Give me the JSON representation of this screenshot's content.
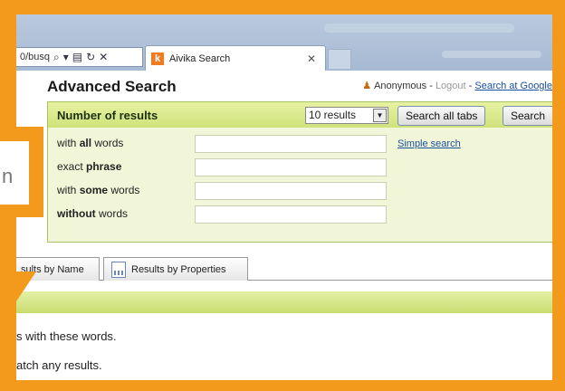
{
  "browser": {
    "address_url": "0/busq",
    "tab_title": "Aivika Search",
    "favicon_letter": "k"
  },
  "page": {
    "title": "Advanced Search",
    "user_name": "Anonymous",
    "separator1": " - ",
    "logout_label": "Logout",
    "separator2": " - ",
    "search_google_label": "Search at Google"
  },
  "form": {
    "header": "Number of results",
    "results_select": "10 results",
    "search_all_tabs_label": "Search all tabs",
    "search_label": "Search",
    "simple_search_label": "Simple search",
    "rows": [
      {
        "pre": "with ",
        "bold": "all",
        "post": " words"
      },
      {
        "pre": "exact ",
        "bold": "phrase",
        "post": ""
      },
      {
        "pre": "with ",
        "bold": "some",
        "post": " words"
      },
      {
        "pre": "",
        "bold": "without",
        "post": " words"
      }
    ]
  },
  "result_tabs": {
    "by_name": "sults by Name",
    "by_properties": "Results by Properties"
  },
  "messages": {
    "line1": "s with these words.",
    "line2": "atch any results."
  },
  "overlay": {
    "bubble_letter": "n"
  },
  "colors": {
    "frame_orange": "#f39a1c",
    "panel_green": "#f2f6d8",
    "link_blue": "#1a4fa0"
  }
}
